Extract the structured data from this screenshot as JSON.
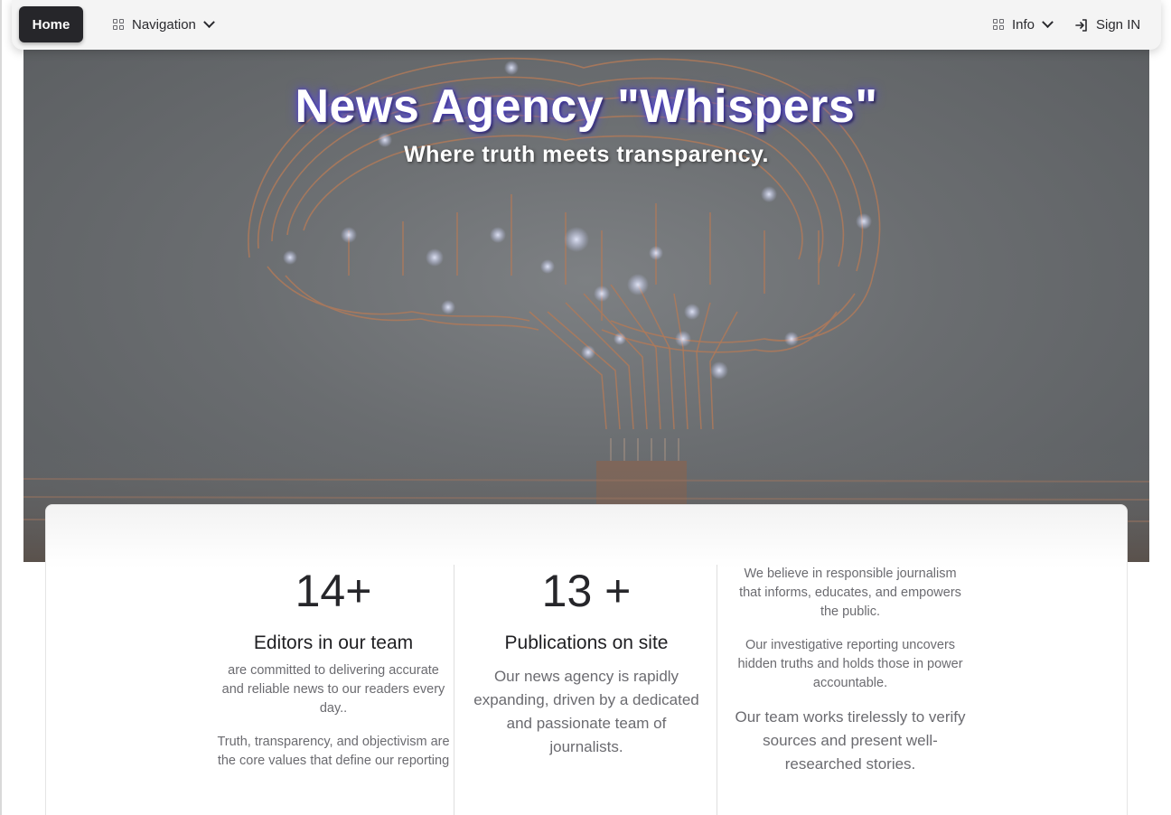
{
  "navbar": {
    "home_label": "Home",
    "navigation_label": "Navigation",
    "info_label": "Info",
    "signin_label": "Sign IN"
  },
  "hero": {
    "title": "News Agency \"Whispers\"",
    "subtitle": "Where truth meets transparency."
  },
  "stats": [
    {
      "number": "14+",
      "title": "Editors in our team",
      "texts": [
        "are committed to delivering accurate and reliable news to our readers every day..",
        "Truth, transparency, and objectivism are the core values that define our reporting"
      ]
    },
    {
      "number": "13 +",
      "title": "Publications on site",
      "texts": [
        "Our news agency is rapidly expanding, driven by a dedicated and passionate team of journalists."
      ]
    },
    {
      "texts": [
        "We believe in responsible journalism that informs, educates, and empowers the public.",
        "Our investigative reporting uncovers hidden truths and holds those in power accountable.",
        "Our team works tirelessly to verify sources and present well-researched stories."
      ]
    }
  ],
  "colors": {
    "home_bg": "#26262a",
    "hero_glow": "#5b4fd6",
    "circuit": "#b07a5a"
  }
}
